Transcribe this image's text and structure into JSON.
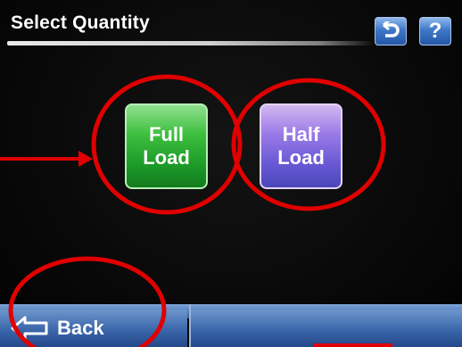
{
  "header": {
    "title": "Select Quantity",
    "return_icon": "return-arrow-icon",
    "help_label": "?"
  },
  "options": [
    {
      "line1": "Full",
      "line2": "Load",
      "color": "#2fb03a"
    },
    {
      "line1": "Half",
      "line2": "Load",
      "color": "#7a66de"
    }
  ],
  "footer": {
    "back_label": "Back",
    "back_icon": "back-arrow-icon"
  },
  "annotation_color": "#e00000"
}
